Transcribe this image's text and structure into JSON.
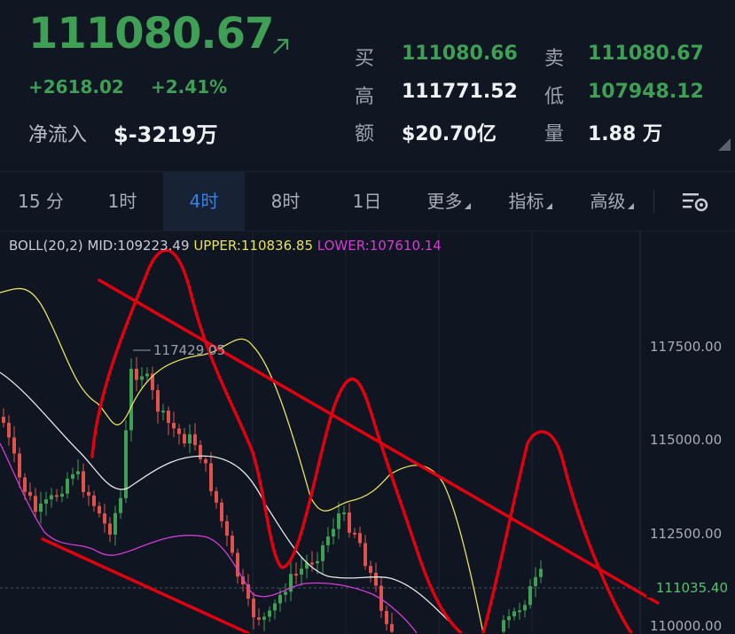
{
  "quote": {
    "last_price": "111080.67",
    "change": "+2618.02",
    "change_pct": "+2.41%",
    "net_inflow_label": "净流入",
    "net_inflow_value": "$-3219万"
  },
  "stats": {
    "buy_label": "买",
    "buy_value": "111080.66",
    "sell_label": "卖",
    "sell_value": "111080.67",
    "high_label": "高",
    "high_value": "111771.52",
    "low_label": "低",
    "low_value": "107948.12",
    "amount_label": "额",
    "amount_value": "$20.70亿",
    "volume_label": "量",
    "volume_value": "1.88 万"
  },
  "tabs": [
    {
      "label": "15 分"
    },
    {
      "label": "1时"
    },
    {
      "label": "4时",
      "active": true
    },
    {
      "label": "8时"
    },
    {
      "label": "1日"
    },
    {
      "label": "更多"
    },
    {
      "label": "指标"
    },
    {
      "label": "高级"
    }
  ],
  "indicator": {
    "name": "BOLL(20,2)",
    "mid": "MID:109223.49",
    "upper": "UPPER:110836.85",
    "lower": "LOWER:107610.14"
  },
  "price_axis": {
    "ticks": [
      "117500.00",
      "115000.00",
      "112500.00",
      "110000.00"
    ],
    "current_price_tag": "111035.40"
  },
  "peak_label": "117429.05",
  "colors": {
    "up": "#3f9f55",
    "down": "#e0524c",
    "boll_mid": "#e8e8e8",
    "boll_upper": "#e8e35a",
    "boll_lower": "#d63bd6",
    "annotation": "#e0000f",
    "active_tab": "#3b7fe0"
  },
  "icons": [
    "arrow-up-right-icon",
    "chart-settings-icon",
    "dropdown-triangle-icon"
  ]
}
